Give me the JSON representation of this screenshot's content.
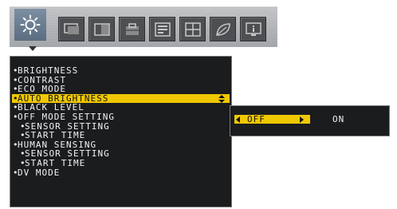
{
  "toolbar": {
    "icons": [
      {
        "name": "brightness-icon",
        "active": true
      },
      {
        "name": "display-position-icon",
        "active": false
      },
      {
        "name": "picture-mode-icon",
        "active": false
      },
      {
        "name": "tools-icon",
        "active": false
      },
      {
        "name": "menu-tools-icon",
        "active": false
      },
      {
        "name": "multi-picture-icon",
        "active": false
      },
      {
        "name": "eco-leaf-icon",
        "active": false
      },
      {
        "name": "information-icon",
        "active": false
      }
    ]
  },
  "menu": {
    "items": [
      {
        "label": "BRIGHTNESS"
      },
      {
        "label": "CONTRAST"
      },
      {
        "label": "ECO MODE"
      },
      {
        "label": "AUTO BRIGHTNESS",
        "selected": true
      },
      {
        "label": "BLACK LEVEL"
      },
      {
        "label": "OFF MODE SETTING"
      },
      {
        "label": "SENSOR SETTING",
        "indent": true
      },
      {
        "label": "START TIME",
        "indent": true
      },
      {
        "label": "HUMAN SENSING"
      },
      {
        "label": "SENSOR SETTING",
        "indent": true
      },
      {
        "label": "START TIME",
        "indent": true
      },
      {
        "label": "DV MODE"
      }
    ]
  },
  "submenu": {
    "selected_option": "OFF",
    "other_option": "ON"
  },
  "colors": {
    "highlight": "#f0c800",
    "menu_bg": "#1b1c1e",
    "toolbar_active": "#6b7d90"
  }
}
